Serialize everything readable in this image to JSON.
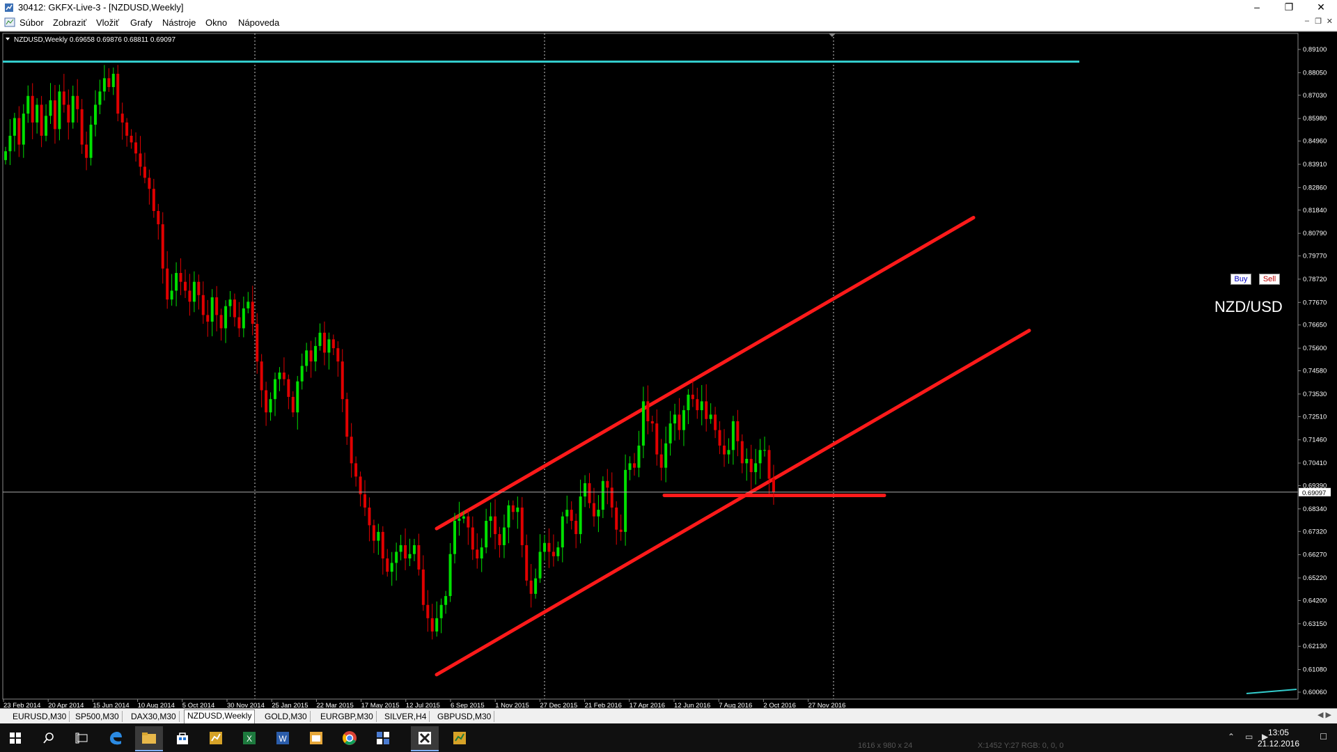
{
  "window": {
    "title": "30412: GKFX-Live-3 - [NZDUSD,Weekly]"
  },
  "menu": [
    "Súbor",
    "Zobraziť",
    "Vložiť",
    "Grafy",
    "Nástroje",
    "Okno",
    "Nápoveda"
  ],
  "chart": {
    "header": "NZDUSD,Weekly  0.69658 0.69876 0.68811 0.69097",
    "symbol_label": "NZD/USD",
    "buy_label": "Buy",
    "sell_label": "Sell",
    "current_price": "0.69097",
    "price_labels": [
      "0.89100",
      "0.88050",
      "0.87030",
      "0.85980",
      "0.84960",
      "0.83910",
      "0.82860",
      "0.81840",
      "0.80790",
      "0.79770",
      "0.78720",
      "0.77670",
      "0.76650",
      "0.75600",
      "0.74580",
      "0.73530",
      "0.72510",
      "0.71460",
      "0.70410",
      "0.69390",
      "0.68340",
      "0.67320",
      "0.66270",
      "0.65220",
      "0.64200",
      "0.63150",
      "0.62130",
      "0.61080",
      "0.60060"
    ],
    "date_labels": [
      "23 Feb 2014",
      "20 Apr 2014",
      "15 Jun 2014",
      "10 Aug 2014",
      "5 Oct 2014",
      "30 Nov 2014",
      "25 Jan 2015",
      "22 Mar 2015",
      "17 May 2015",
      "12 Jul 2015",
      "6 Sep 2015",
      "1 Nov 2015",
      "27 Dec 2015",
      "21 Feb 2016",
      "17 Apr 2016",
      "12 Jun 2016",
      "7 Aug 2016",
      "2 Oct 2016",
      "27 Nov 2016"
    ],
    "colors": {
      "bull": "#00e000",
      "bear": "#e00000",
      "trendline": "#ff1a1a",
      "hline": "#33cccc",
      "background": "#000000"
    }
  },
  "chart_data": {
    "type": "candlestick",
    "symbol": "NZDUSD",
    "timeframe": "Weekly",
    "last_bar": {
      "open": 0.69658,
      "high": 0.69876,
      "low": 0.68811,
      "close": 0.69097
    },
    "ylim": [
      0.6006,
      0.891
    ],
    "closes": [
      0.845,
      0.852,
      0.86,
      0.848,
      0.862,
      0.87,
      0.858,
      0.866,
      0.852,
      0.861,
      0.868,
      0.855,
      0.872,
      0.866,
      0.858,
      0.87,
      0.864,
      0.848,
      0.842,
      0.857,
      0.866,
      0.872,
      0.878,
      0.874,
      0.88,
      0.862,
      0.858,
      0.852,
      0.849,
      0.844,
      0.838,
      0.833,
      0.828,
      0.818,
      0.812,
      0.792,
      0.778,
      0.782,
      0.79,
      0.786,
      0.782,
      0.777,
      0.786,
      0.78,
      0.771,
      0.768,
      0.779,
      0.771,
      0.765,
      0.775,
      0.778,
      0.77,
      0.765,
      0.774,
      0.777,
      0.767,
      0.75,
      0.737,
      0.727,
      0.733,
      0.742,
      0.745,
      0.742,
      0.734,
      0.727,
      0.741,
      0.748,
      0.755,
      0.75,
      0.757,
      0.763,
      0.754,
      0.76,
      0.756,
      0.75,
      0.733,
      0.716,
      0.704,
      0.698,
      0.69,
      0.684,
      0.676,
      0.669,
      0.673,
      0.661,
      0.655,
      0.659,
      0.664,
      0.667,
      0.661,
      0.663,
      0.667,
      0.656,
      0.64,
      0.634,
      0.628,
      0.634,
      0.64,
      0.644,
      0.663,
      0.678,
      0.679,
      0.68,
      0.675,
      0.665,
      0.661,
      0.666,
      0.678,
      0.68,
      0.672,
      0.667,
      0.675,
      0.685,
      0.682,
      0.684,
      0.667,
      0.651,
      0.645,
      0.652,
      0.664,
      0.668,
      0.664,
      0.662,
      0.666,
      0.68,
      0.683,
      0.678,
      0.672,
      0.689,
      0.695,
      0.686,
      0.68,
      0.683,
      0.696,
      0.693,
      0.684,
      0.674,
      0.673,
      0.701,
      0.704,
      0.702,
      0.712,
      0.732,
      0.723,
      0.722,
      0.708,
      0.702,
      0.713,
      0.722,
      0.726,
      0.719,
      0.728,
      0.735,
      0.733,
      0.728,
      0.732,
      0.724,
      0.726,
      0.719,
      0.712,
      0.708,
      0.71,
      0.723,
      0.714,
      0.704,
      0.706,
      0.7,
      0.704,
      0.71,
      0.71,
      0.697,
      0.691
    ],
    "trendlines": [
      {
        "from": [
          "Jul 2015",
          0.6745
        ],
        "to": [
          "Feb 2017",
          0.815
        ]
      },
      {
        "from": [
          "Jul 2015",
          0.6085
        ],
        "to": [
          "Mar 2017",
          0.764
        ]
      },
      {
        "from": [
          "Jun 2016",
          0.6895
        ],
        "to": [
          "Jan 2017",
          0.6895
        ]
      }
    ],
    "horizontal_line": 0.8855
  },
  "tabs": [
    "EURUSD,M30",
    "SP500,M30",
    "DAX30,M30",
    "NZDUSD,Weekly",
    "GOLD,M30",
    "EURGBP,M30",
    "SILVER,H4",
    "GBPUSD,M30"
  ],
  "active_tab": "NZDUSD,Weekly",
  "taskbar": {
    "time": "13:05",
    "date": "21.12.2016",
    "status_ghost_1": "1616 x 980 x 24",
    "status_ghost_2": "X:1452 Y:27   RGB: 0, 0, 0"
  }
}
